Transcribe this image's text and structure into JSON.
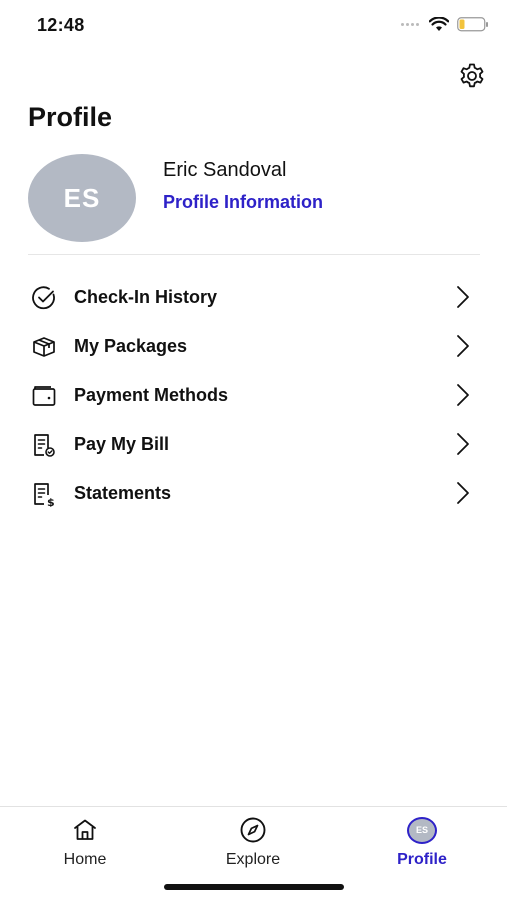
{
  "status_bar": {
    "time": "12:48"
  },
  "page": {
    "title": "Profile"
  },
  "user": {
    "initials": "ES",
    "name": "Eric Sandoval",
    "profile_link": "Profile Information"
  },
  "menu": {
    "items": [
      {
        "label": "Check-In History",
        "icon": "check-circle-icon"
      },
      {
        "label": "My Packages",
        "icon": "package-box-icon"
      },
      {
        "label": "Payment Methods",
        "icon": "wallet-icon"
      },
      {
        "label": "Pay My Bill",
        "icon": "bill-check-icon"
      },
      {
        "label": "Statements",
        "icon": "statement-dollar-icon"
      }
    ]
  },
  "tab_bar": {
    "tabs": [
      {
        "label": "Home",
        "icon": "home-icon"
      },
      {
        "label": "Explore",
        "icon": "compass-icon"
      },
      {
        "label": "Profile",
        "icon": "avatar",
        "initials": "ES"
      }
    ],
    "active": "Profile"
  },
  "colors": {
    "accent": "#2e22c8",
    "avatar_bg": "#b3b9c4",
    "divider": "#e6e6e6"
  }
}
